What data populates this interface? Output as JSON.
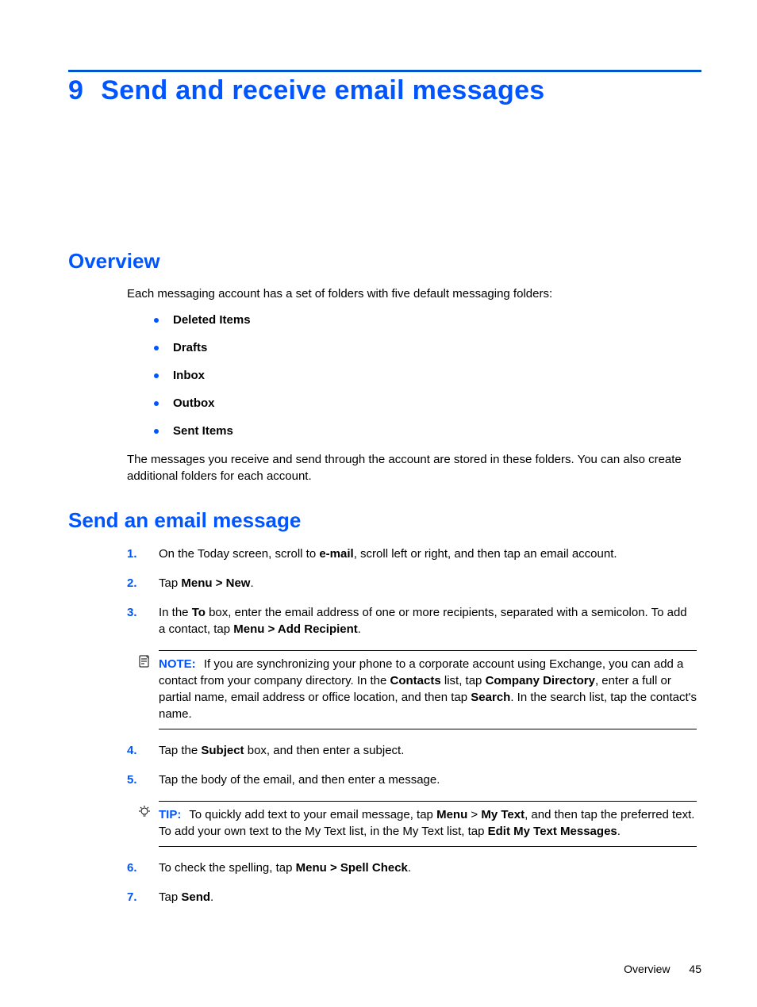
{
  "chapter": {
    "number": "9",
    "title": "Send and receive email messages"
  },
  "overview": {
    "heading": "Overview",
    "intro": "Each messaging account has a set of folders with five default messaging folders:",
    "folders": [
      "Deleted Items",
      "Drafts",
      "Inbox",
      "Outbox",
      "Sent Items"
    ],
    "outro": "The messages you receive and send through the account are stored in these folders. You can also create additional folders for each account."
  },
  "send": {
    "heading": "Send an email message",
    "steps": {
      "s1": {
        "pre": "On the Today screen, scroll to ",
        "b1": "e-mail",
        "post": ", scroll left or right, and then tap an email account."
      },
      "s2": {
        "pre": "Tap ",
        "b1": "Menu > New",
        "post": "."
      },
      "s3": {
        "pre": "In the ",
        "b1": "To",
        "mid": " box, enter the email address of one or more recipients, separated with a semicolon. To add a contact, tap ",
        "b2": "Menu > Add Recipient",
        "post": "."
      },
      "s4": {
        "pre": "Tap the ",
        "b1": "Subject",
        "post": " box, and then enter a subject."
      },
      "s5": {
        "text": "Tap the body of the email, and then enter a message."
      },
      "s6": {
        "pre": "To check the spelling, tap ",
        "b1": "Menu > Spell Check",
        "post": "."
      },
      "s7": {
        "pre": "Tap ",
        "b1": "Send",
        "post": "."
      }
    },
    "note": {
      "label": "NOTE:",
      "t1": "If you are synchronizing your phone to a corporate account using Exchange, you can add a contact from your company directory. In the ",
      "b1": "Contacts",
      "t2": " list, tap ",
      "b2": "Company Directory",
      "t3": ", enter a full or partial name, email address or office location, and then tap ",
      "b3": "Search",
      "t4": ". In the search list, tap the contact's name."
    },
    "tip": {
      "label": "TIP:",
      "t1": "To quickly add text to your email message, tap ",
      "b1": "Menu",
      "t2": " > ",
      "b2": "My Text",
      "t3": ", and then tap the preferred text. To add your own text to the My Text list, in the My Text list, tap ",
      "b3": "Edit My Text Messages",
      "t4": "."
    }
  },
  "footer": {
    "section": "Overview",
    "page": "45"
  }
}
